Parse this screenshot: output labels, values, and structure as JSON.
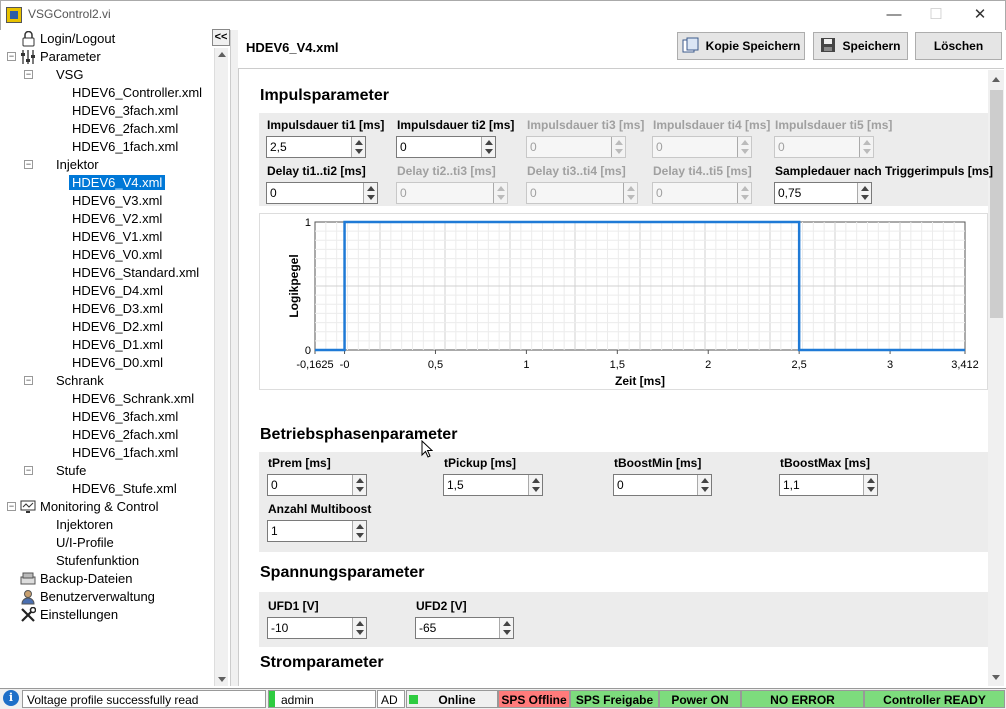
{
  "window": {
    "title": "VSGControl2.vi",
    "minimize": "—",
    "maximize": "☐",
    "close": "✕"
  },
  "sidebar": {
    "collapse_label": "<<",
    "login": "Login/Logout",
    "parameter": "Parameter",
    "vsg": "VSG",
    "vsg_items": [
      "HDEV6_Controller.xml",
      "HDEV6_3fach.xml",
      "HDEV6_2fach.xml",
      "HDEV6_1fach.xml"
    ],
    "injektor": "Injektor",
    "injektor_items": [
      "HDEV6_V4.xml",
      "HDEV6_V3.xml",
      "HDEV6_V2.xml",
      "HDEV6_V1.xml",
      "HDEV6_V0.xml",
      "HDEV6_Standard.xml",
      "HDEV6_D4.xml",
      "HDEV6_D3.xml",
      "HDEV6_D2.xml",
      "HDEV6_D1.xml",
      "HDEV6_D0.xml"
    ],
    "schrank": "Schrank",
    "schrank_items": [
      "HDEV6_Schrank.xml",
      "HDEV6_3fach.xml",
      "HDEV6_2fach.xml",
      "HDEV6_1fach.xml"
    ],
    "stufe": "Stufe",
    "stufe_items": [
      "HDEV6_Stufe.xml"
    ],
    "monitoring": "Monitoring & Control",
    "monitoring_items": [
      "Injektoren",
      "U/I-Profile",
      "Stufenfunktion"
    ],
    "backup": "Backup-Dateien",
    "users": "Benutzerverwaltung",
    "settings": "Einstellungen"
  },
  "header": {
    "file": "HDEV6_V4.xml",
    "copy_save": "Kopie Speichern",
    "save": "Speichern",
    "delete": "Löschen"
  },
  "impuls": {
    "title": "Impulsparameter",
    "row1": [
      {
        "label": "Impulsdauer ti1 [ms]",
        "value": "2,5",
        "enabled": true
      },
      {
        "label": "Impulsdauer ti2 [ms]",
        "value": "0",
        "enabled": true
      },
      {
        "label": "Impulsdauer ti3 [ms]",
        "value": "0",
        "enabled": false
      },
      {
        "label": "Impulsdauer ti4 [ms]",
        "value": "0",
        "enabled": false
      },
      {
        "label": "Impulsdauer ti5 [ms]",
        "value": "0",
        "enabled": false
      }
    ],
    "row2": [
      {
        "label": "Delay ti1..ti2 [ms]",
        "value": "0",
        "enabled": true
      },
      {
        "label": "Delay ti2..ti3 [ms]",
        "value": "0",
        "enabled": false
      },
      {
        "label": "Delay ti3..ti4 [ms]",
        "value": "0",
        "enabled": false
      },
      {
        "label": "Delay ti4..ti5 [ms]",
        "value": "0",
        "enabled": false
      },
      {
        "label": "Sampledauer nach Triggerimpuls [ms]",
        "value": "0,75",
        "enabled": true
      }
    ]
  },
  "chart_data": {
    "type": "line",
    "xlabel": "Zeit [ms]",
    "ylabel": "Logikpegel",
    "xlim": [
      -0.1625,
      3.412
    ],
    "ylim": [
      0,
      1
    ],
    "xticks": [
      "-0,1625",
      "-0",
      "0,5",
      "1",
      "1,5",
      "2",
      "2,5",
      "3",
      "3,412"
    ],
    "xtick_values": [
      -0.1625,
      0,
      0.5,
      1,
      1.5,
      2,
      2.5,
      3,
      3.412
    ],
    "yticks": [
      "0",
      "1"
    ],
    "series": [
      {
        "x": [
          -0.1625,
          0,
          0,
          2.5,
          2.5,
          3.412
        ],
        "y": [
          0,
          0,
          1,
          1,
          0,
          0
        ]
      }
    ],
    "line_color": "#1f7ad6",
    "grid": true
  },
  "betrieb": {
    "title": "Betriebsphasenparameter",
    "fields": [
      {
        "label": "tPrem [ms]",
        "value": "0"
      },
      {
        "label": "tPickup [ms]",
        "value": "1,5"
      },
      {
        "label": "tBoostMin [ms]",
        "value": "0"
      },
      {
        "label": "tBoostMax [ms]",
        "value": "1,1"
      },
      {
        "label": "Anzahl Multiboost",
        "value": "1"
      }
    ]
  },
  "spannung": {
    "title": "Spannungsparameter",
    "fields": [
      {
        "label": "UFD1 [V]",
        "value": "-10"
      },
      {
        "label": "UFD2 [V]",
        "value": "-65"
      }
    ]
  },
  "strom": {
    "title": "Stromparameter"
  },
  "status": {
    "message": "Voltage profile successfully read",
    "user": "admin",
    "ad": "AD",
    "online": "Online",
    "sps_offline": "SPS Offline",
    "sps_freigabe": "SPS Freigabe",
    "power": "Power ON",
    "error": "NO ERROR",
    "controller": "Controller READY",
    "colors": {
      "green": "#7ddc7d",
      "red": "#ff7b7b"
    }
  }
}
